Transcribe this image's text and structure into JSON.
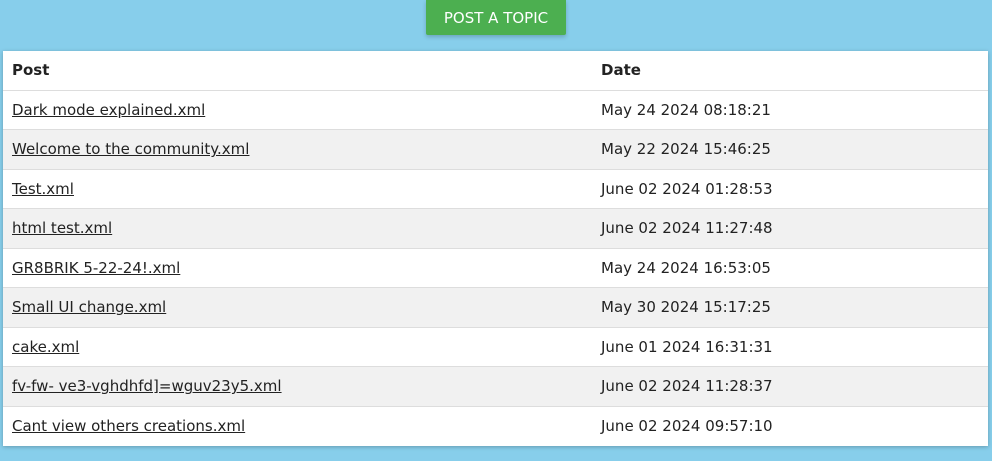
{
  "toolbar": {
    "post_topic_label": "POST A TOPIC"
  },
  "table": {
    "headers": {
      "post": "Post",
      "date": "Date"
    },
    "rows": [
      {
        "post": "Dark mode explained.xml",
        "date": "May 24 2024 08:18:21"
      },
      {
        "post": "Welcome to the community.xml",
        "date": "May 22 2024 15:46:25"
      },
      {
        "post": "Test.xml",
        "date": "June 02 2024 01:28:53"
      },
      {
        "post": "html test.xml",
        "date": "June 02 2024 11:27:48"
      },
      {
        "post": "GR8BRIK 5-22-24!.xml",
        "date": "May 24 2024 16:53:05"
      },
      {
        "post": "Small UI change.xml",
        "date": "May 30 2024 15:17:25"
      },
      {
        "post": "cake.xml",
        "date": "June 01 2024 16:31:31"
      },
      {
        "post": "fv-fw- ve3-vghdhfd]=wguv23y5.xml",
        "date": "June 02 2024 11:28:37"
      },
      {
        "post": "Cant view others creations.xml",
        "date": "June 02 2024 09:57:10"
      }
    ]
  },
  "colors": {
    "background": "#87ceeb",
    "button": "#4caf50",
    "row_alt": "#f1f1f1"
  }
}
